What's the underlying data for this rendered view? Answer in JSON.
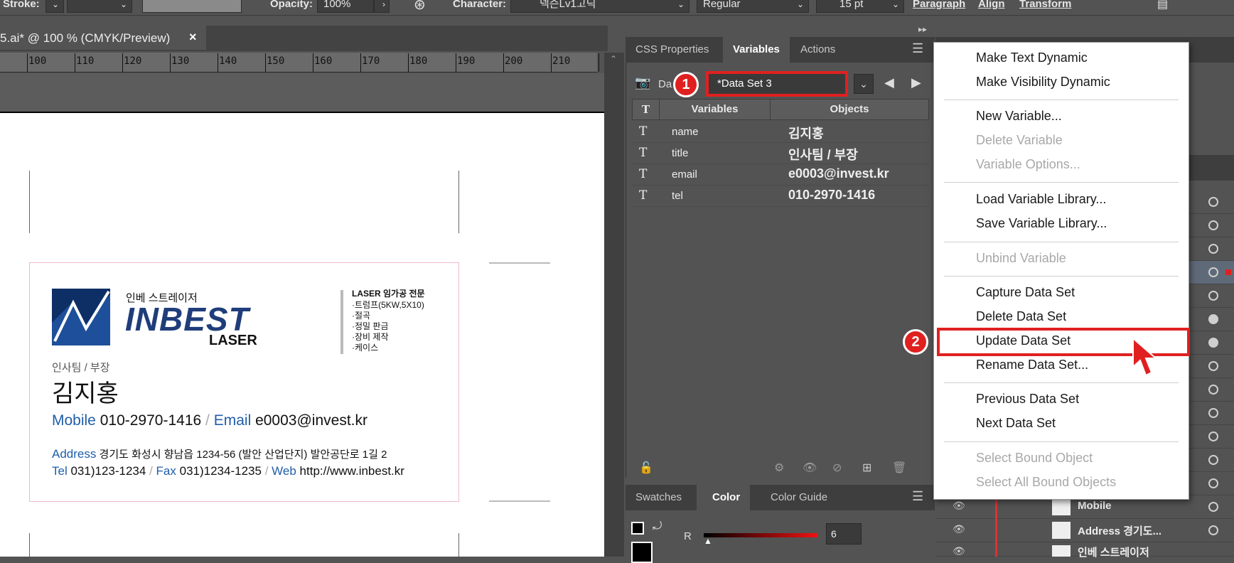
{
  "topbar": {
    "stroke_label": "Stroke:",
    "opacity_label": "Opacity:",
    "opacity_value": "100%",
    "character_label": "Character:",
    "font_name": "넥슨Lv1고딕",
    "font_style": "Regular",
    "font_size": "15 pt",
    "paragraph": "Paragraph",
    "align": "Align",
    "transform": "Transform"
  },
  "document": {
    "tab_title": "5.ai* @ 100 % (CMYK/Preview)",
    "close": "×",
    "ruler_ticks": [
      "100",
      "110",
      "120",
      "130",
      "140",
      "150",
      "160",
      "170",
      "180",
      "190",
      "200",
      "210"
    ]
  },
  "panel": {
    "tabs": [
      "CSS Properties",
      "Variables",
      "Actions"
    ],
    "dataset_label": "Da",
    "dataset_value": "*Data Set 3",
    "col_type": "T",
    "col_variables": "Variables",
    "col_objects": "Objects",
    "rows": [
      {
        "type": "T",
        "name": "name",
        "object": "김지홍"
      },
      {
        "type": "T",
        "name": "title",
        "object": "인사팀 / 부장"
      },
      {
        "type": "T",
        "name": "email",
        "object": "e0003@invest.kr"
      },
      {
        "type": "T",
        "name": "tel",
        "object": "010-2970-1416"
      }
    ],
    "badge1": "1",
    "badge2": "2"
  },
  "color_panel": {
    "tabs": [
      "Swatches",
      "Color",
      "Color Guide"
    ],
    "channel": "R",
    "value": "6"
  },
  "menu": {
    "items": [
      {
        "label": "Make Text Dynamic",
        "enabled": true
      },
      {
        "label": "Make Visibility Dynamic",
        "enabled": true
      },
      {
        "label": "New Variable...",
        "enabled": true
      },
      {
        "label": "Delete Variable",
        "enabled": false
      },
      {
        "label": "Variable Options...",
        "enabled": false
      },
      {
        "label": "Load Variable Library...",
        "enabled": true
      },
      {
        "label": "Save Variable Library...",
        "enabled": true
      },
      {
        "label": "Unbind Variable",
        "enabled": false
      },
      {
        "label": "Capture Data Set",
        "enabled": true
      },
      {
        "label": "Delete Data Set",
        "enabled": true
      },
      {
        "label": "Update Data Set",
        "enabled": true
      },
      {
        "label": "Rename Data Set...",
        "enabled": true
      },
      {
        "label": "Previous Data Set",
        "enabled": true
      },
      {
        "label": "Next Data Set",
        "enabled": true
      },
      {
        "label": "Select Bound Object",
        "enabled": false
      },
      {
        "label": "Select All Bound Objects",
        "enabled": false
      }
    ]
  },
  "layers": {
    "items": [
      "Mobile",
      "Address 경기도...",
      "인베 스트레이저"
    ]
  },
  "card": {
    "company_kr": "인베 스트레이저",
    "brand": "INBEST",
    "brand_sub": "LASER",
    "services_title": "LASER 임가공 전문",
    "services": [
      "·트럼프(5KW,5X10)",
      "·절곡",
      "·정밀 판금",
      "·장비 제작",
      "·케이스"
    ],
    "title": "인사팀 / 부장",
    "name": "김지홍",
    "mobile_label": "Mobile",
    "mobile": "010-2970-1416",
    "email_label": "Email",
    "email": "e0003@invest.kr",
    "address_label": "Address",
    "address": "경기도 화성시 향남읍 1234-56 (발안 산업단지) 발안공단로 1길 2",
    "tel_label": "Tel",
    "tel": "031)123-1234",
    "fax_label": "Fax",
    "fax": "031)1234-1235",
    "web_label": "Web",
    "web": "http://www.inbest.kr",
    "sep": "/"
  },
  "colors": {
    "highlight": "#e02020",
    "brand_blue": "#1f5ea8"
  }
}
